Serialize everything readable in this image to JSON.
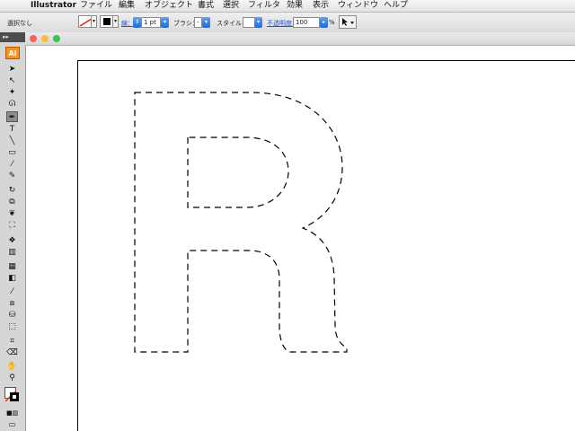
{
  "menubar": {
    "app_name": "Illustrator",
    "items": [
      "ファイル",
      "編集",
      "オブジェクト",
      "書式",
      "選択",
      "フィルタ",
      "効果",
      "表示",
      "ウィンドウ",
      "ヘルプ"
    ]
  },
  "controlbar": {
    "selection_label": "選択なし",
    "stroke_label": "線：",
    "stroke_weight": "1 pt",
    "brush_label": "ブラシ：",
    "brush_value": "-",
    "style_label": "スタイル：",
    "opacity_label": "不透明度：",
    "opacity_value": "100",
    "percent": "%"
  },
  "toolpanel": {
    "collapse": "▸▸",
    "logo": "Ai"
  },
  "colors": {
    "logo": "#f7931e",
    "close": "#fc605c",
    "minimize": "#fdbc40",
    "zoom": "#34c84a",
    "link": "#1d55d6"
  }
}
